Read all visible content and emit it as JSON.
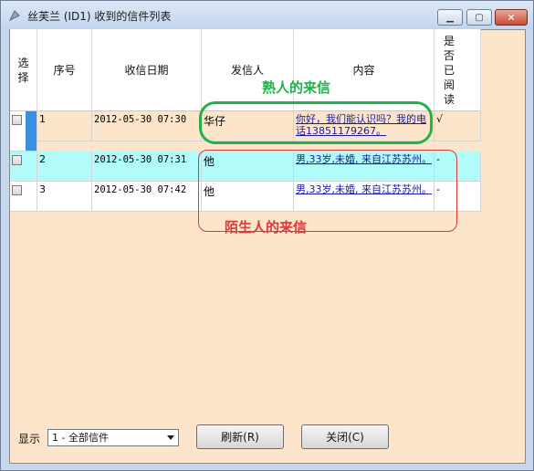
{
  "window": {
    "title": "丝芙兰 (ID1) 收到的信件列表"
  },
  "columns": {
    "select": "选\n择",
    "index": "序号",
    "date": "收信日期",
    "sender": "发信人",
    "content": "内容",
    "read": "是\n否\n已\n阅\n读"
  },
  "rows": [
    {
      "index": "1",
      "date": "2012-05-30 07:30",
      "sender": "华仔",
      "content": "你好，我们能认识吗？我的电话13851179267。",
      "read": "√",
      "selected": true,
      "highlight": false
    },
    {
      "index": "2",
      "date": "2012-05-30 07:31",
      "sender": "他",
      "content": "男,33岁,未婚, 来自江苏苏州。",
      "read": "-",
      "selected": false,
      "highlight": true
    },
    {
      "index": "3",
      "date": "2012-05-30 07:42",
      "sender": "他",
      "content": "男,33岁,未婚, 来自江苏苏州。",
      "read": "-",
      "selected": false,
      "highlight": false
    }
  ],
  "annotations": {
    "acquaintance": "熟人的来信",
    "stranger": "陌生人的来信"
  },
  "footer": {
    "show_label": "显示",
    "filter_value": "1 - 全部信件",
    "refresh_label": "刷新(R)",
    "close_label": "关闭(C)"
  },
  "colors": {
    "highlight_row": "#b2fbfb",
    "selected_marker": "#3a8fe0",
    "client_bg": "#fde5cb",
    "annot_green": "#21b24a",
    "annot_red": "#d93a3a"
  }
}
